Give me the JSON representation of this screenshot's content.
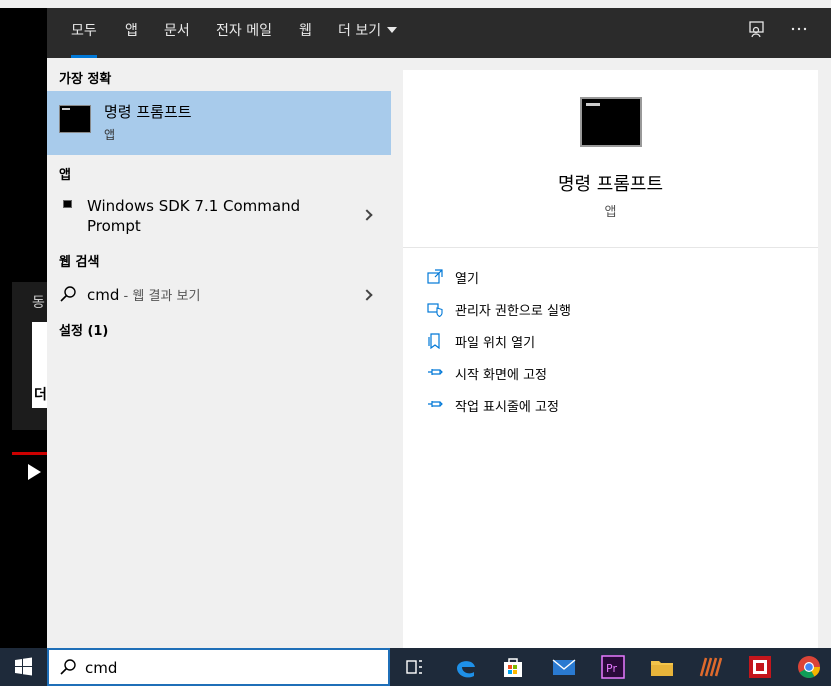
{
  "background": {
    "video_text": "동",
    "video_text2": "더"
  },
  "tabs": [
    {
      "label": "모두",
      "active": true
    },
    {
      "label": "앱"
    },
    {
      "label": "문서"
    },
    {
      "label": "전자 메일"
    },
    {
      "label": "웹"
    },
    {
      "label": "더 보기"
    }
  ],
  "topbar_icons": [
    "feedback-icon",
    "more-options-icon"
  ],
  "left": {
    "best_match_header": "가장 정확",
    "best_match": {
      "title": "명령 프롬프트",
      "subtitle": "앱"
    },
    "apps_header": "앱",
    "apps": [
      {
        "line1": "Windows SDK 7.1 Command",
        "line2": "Prompt"
      }
    ],
    "web_header": "웹 검색",
    "web_item": {
      "query": "cmd",
      "suffix": " - 웹 결과 보기"
    },
    "settings_header": "설정 (1)"
  },
  "right": {
    "title": "명령 프롬프트",
    "subtitle": "앱",
    "actions": [
      {
        "label": "열기",
        "icon": "open-icon"
      },
      {
        "label": "관리자 권한으로 실행",
        "icon": "admin-shield-icon"
      },
      {
        "label": "파일 위치 열기",
        "icon": "file-location-icon"
      },
      {
        "label": "시작 화면에 고정",
        "icon": "pin-start-icon"
      },
      {
        "label": "작업 표시줄에 고정",
        "icon": "pin-taskbar-icon"
      }
    ]
  },
  "taskbar": {
    "search_value": "cmd",
    "apps": [
      "task-view-icon",
      "edge-icon",
      "store-icon",
      "mail-icon",
      "premiere-icon",
      "file-explorer-icon",
      "app-stripes-icon",
      "app-red-icon",
      "chrome-icon"
    ]
  },
  "colors": {
    "accent": "#0078d7",
    "selection": "#a8cbeb",
    "topbar": "#2b2b2b",
    "taskbar": "#1e2a3a"
  }
}
